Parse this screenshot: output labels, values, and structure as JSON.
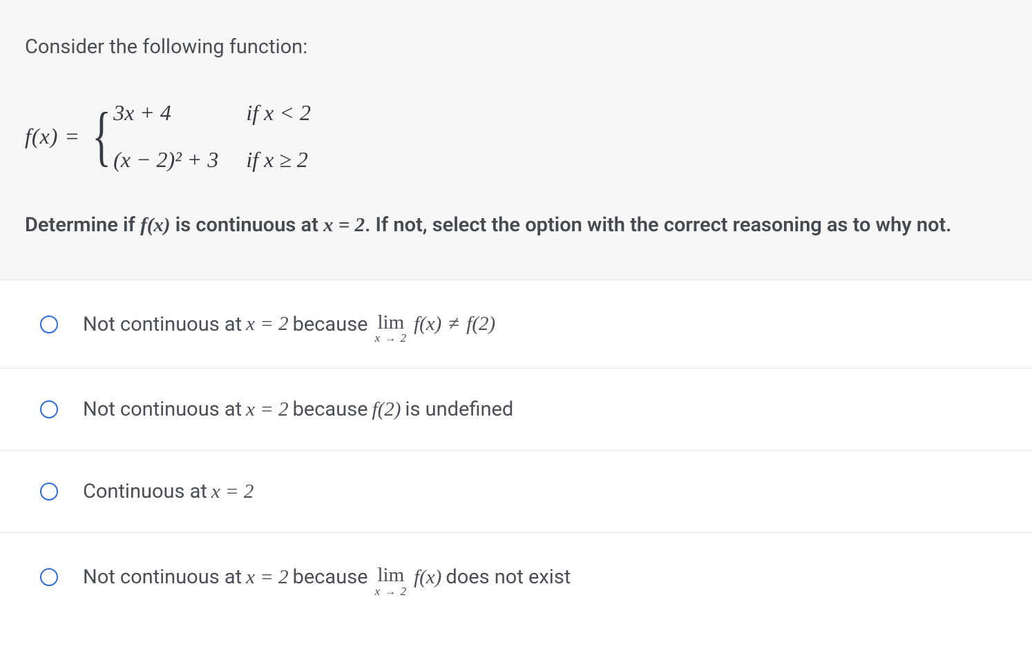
{
  "question": {
    "intro": "Consider the following function:",
    "fx_label": "f(x) = ",
    "pieces": {
      "p1_expr": "3x + 4",
      "p1_cond": "if x < 2",
      "p2_expr": "(x − 2)² + 3",
      "p2_cond": "if x ≥ 2"
    },
    "prompt_1": "Determine if ",
    "prompt_fx": "f(x)",
    "prompt_2": " is continuous at ",
    "prompt_xeq": "x = 2",
    "prompt_3": ". If not, select the option with the correct reasoning as to why not."
  },
  "options": {
    "a": {
      "pre": "Not continuous at ",
      "xeq": "x = 2",
      "mid": " because  ",
      "lim_top": "lim",
      "lim_bot": "x → 2",
      "lim_fx": "f(x)",
      "neq": "≠",
      "f2": "f(2)"
    },
    "b": {
      "pre": "Not continuous at ",
      "xeq": "x = 2",
      "mid": " because  ",
      "f2": "f(2)",
      "tail": " is undefined"
    },
    "c": {
      "pre": "Continuous at ",
      "xeq": "x = 2"
    },
    "d": {
      "pre": "Not continuous at ",
      "xeq": "x = 2",
      "mid": " because  ",
      "lim_top": "lim",
      "lim_bot": "x → 2",
      "lim_fx": "f(x)",
      "tail": " does not exist"
    }
  }
}
